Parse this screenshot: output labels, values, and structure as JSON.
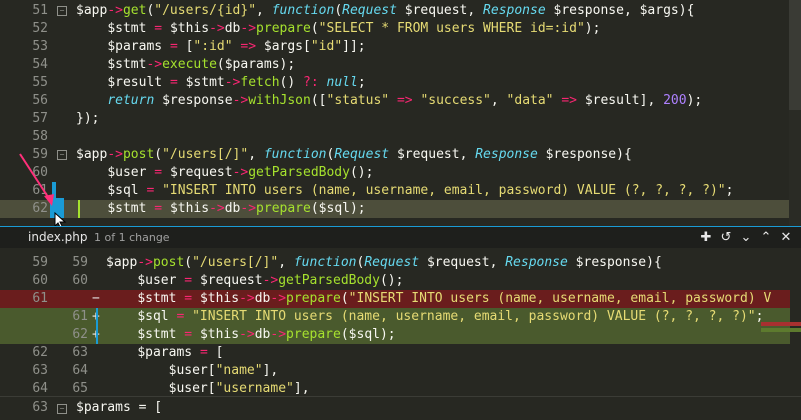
{
  "editor": {
    "lines": [
      {
        "n": "51",
        "fold": true,
        "text": "$app->get(\"/users/{id}\", function(Request $request, Response $response, $args){"
      },
      {
        "n": "52",
        "text": "    $stmt = $this->db->prepare(\"SELECT * FROM users WHERE id=:id\");"
      },
      {
        "n": "53",
        "text": "    $params = [\":id\" => $args[\"id\"]];"
      },
      {
        "n": "54",
        "text": "    $stmt->execute($params);"
      },
      {
        "n": "55",
        "text": "    $result = $stmt->fetch() ?: null;"
      },
      {
        "n": "56",
        "text": "    return $response->withJson([\"status\" => \"success\", \"data\" => $result], 200);"
      },
      {
        "n": "57",
        "text": "});"
      },
      {
        "n": "58",
        "text": ""
      },
      {
        "n": "59",
        "fold": true,
        "text": "$app->post(\"/users[/]\", function(Request $request, Response $response){"
      },
      {
        "n": "60",
        "text": "    $user = $request->getParsedBody();"
      },
      {
        "n": "61",
        "text": "    $sql = \"INSERT INTO users (name, username, email, password) VALUE (?, ?, ?, ?)\";"
      },
      {
        "n": "62",
        "text": "    $stmt = $this->db->prepare($sql);"
      }
    ]
  },
  "diff_toolbar": {
    "file": "index.php",
    "count": "1 of 1 change",
    "icons": [
      "plus-icon",
      "revert-icon",
      "chevron-down-icon",
      "chevron-up-icon",
      "close-icon"
    ]
  },
  "diff": {
    "lines": [
      {
        "o": "59",
        "n": "59",
        "sign": "",
        "type": "ctx",
        "text": "$app->post(\"/users[/]\", function(Request $request, Response $response){"
      },
      {
        "o": "60",
        "n": "60",
        "sign": "",
        "type": "ctx",
        "text": "    $user = $request->getParsedBody();"
      },
      {
        "o": "61",
        "n": "",
        "sign": "−",
        "type": "del",
        "text": "    $stmt = $this->db->prepare(\"INSERT INTO users (name, username, email, password) V"
      },
      {
        "o": "",
        "n": "61",
        "sign": "+",
        "type": "add",
        "text": "    $sql = \"INSERT INTO users (name, username, email, password) VALUE (?, ?, ?, ?)\";"
      },
      {
        "o": "",
        "n": "62",
        "sign": "+",
        "type": "add",
        "text": "    $stmt = $this->db->prepare($sql);"
      },
      {
        "o": "62",
        "n": "63",
        "sign": "",
        "type": "ctx",
        "text": "    $params = ["
      },
      {
        "o": "63",
        "n": "64",
        "sign": "",
        "type": "ctx",
        "text": "        $user[\"name\"],"
      },
      {
        "o": "64",
        "n": "65",
        "sign": "",
        "type": "ctx",
        "text": "        $user[\"username\"],"
      }
    ]
  },
  "bottom": {
    "n": "63",
    "text": "    $params = ["
  },
  "colors": {
    "accent": "#1a9bd5",
    "bg": "#272822",
    "added": "#4a5a2d",
    "deleted": "#6a1d1d"
  }
}
